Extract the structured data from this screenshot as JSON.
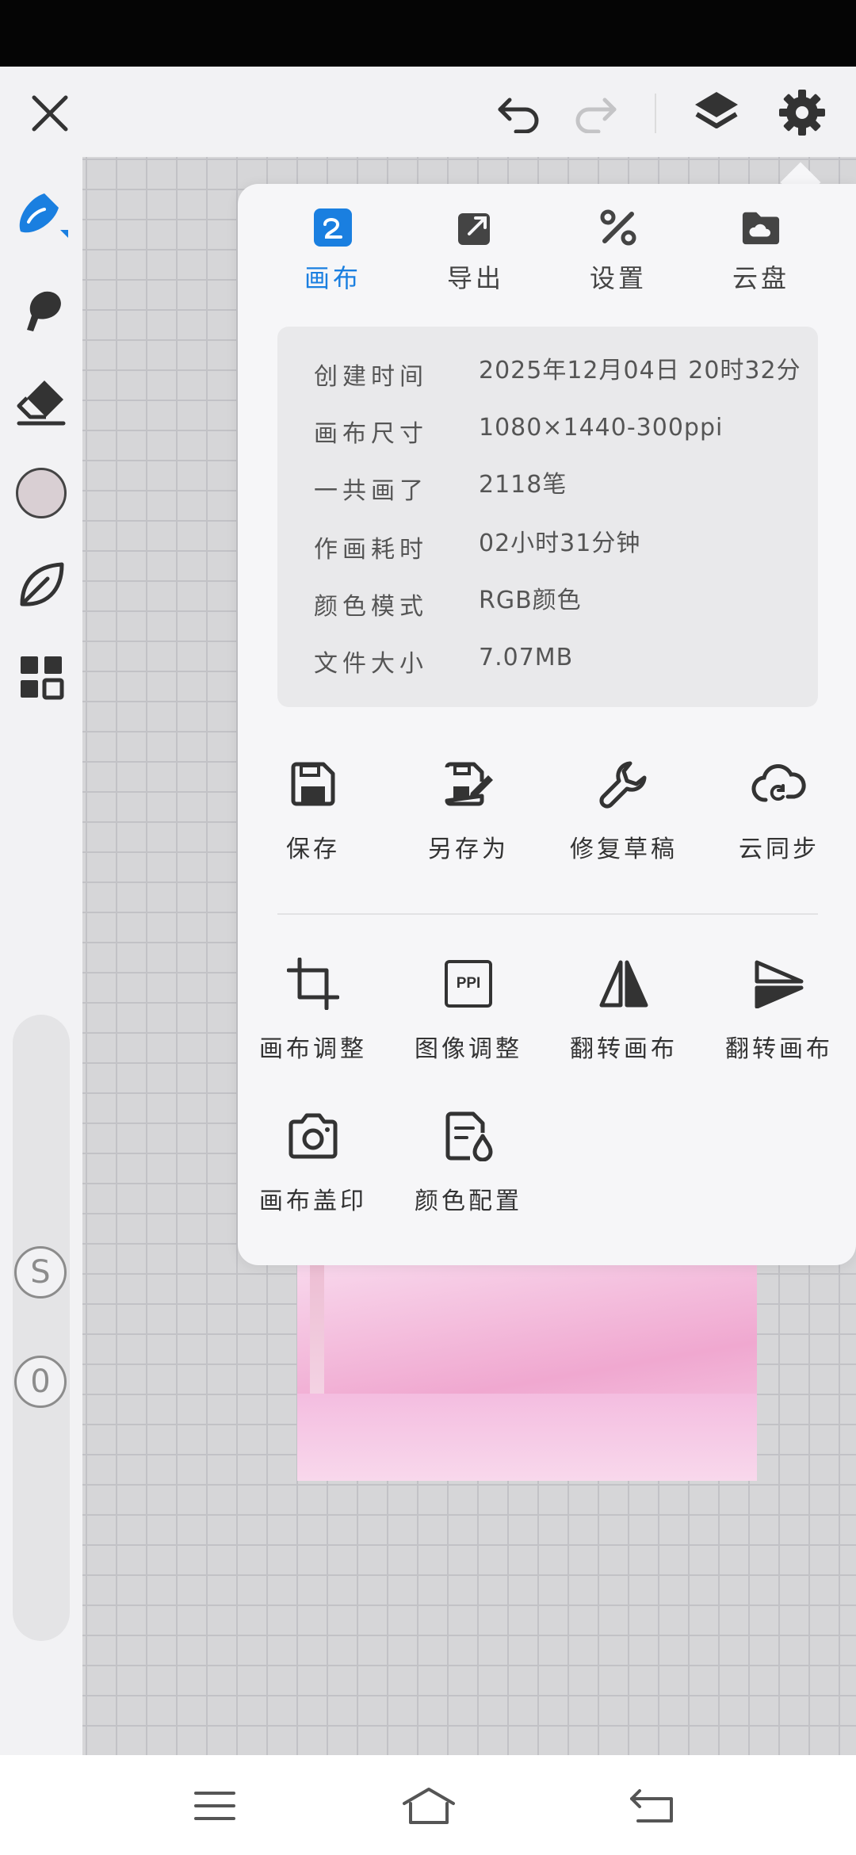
{
  "top_toolbar": {
    "icons": [
      "close-icon",
      "undo-icon",
      "redo-icon",
      "layers-icon",
      "settings-icon"
    ]
  },
  "left_toolbar": {
    "tools": [
      "brush-icon",
      "smudge-icon",
      "eraser-icon",
      "color-swatch",
      "leaf-icon",
      "grid-icon"
    ],
    "current_color": "#d9cfd3",
    "s_button": "S",
    "zero_button": "0"
  },
  "panel": {
    "tabs": [
      {
        "label": "画布",
        "icon": "canvas-icon",
        "active": true
      },
      {
        "label": "导出",
        "icon": "export-icon",
        "active": false
      },
      {
        "label": "设置",
        "icon": "settings-tools-icon",
        "active": false
      },
      {
        "label": "云盘",
        "icon": "cloud-drive-icon",
        "active": false
      }
    ],
    "info": {
      "created_label": "创建时间",
      "created_value": "2025年12月04日 20时32分",
      "size_label": "画布尺寸",
      "size_value": "1080×1440-300ppi",
      "strokes_label": "一共画了",
      "strokes_value": "2118笔",
      "duration_label": "作画耗时",
      "duration_value": "02小时31分钟",
      "color_mode_label": "颜色模式",
      "color_mode_value": "RGB颜色",
      "file_size_label": "文件大小",
      "file_size_value": "7.07MB"
    },
    "actions_row1": [
      {
        "label": "保存",
        "icon": "save-icon"
      },
      {
        "label": "另存为",
        "icon": "save-as-icon"
      },
      {
        "label": "修复草稿",
        "icon": "repair-icon"
      },
      {
        "label": "云同步",
        "icon": "cloud-sync-icon"
      }
    ],
    "actions_row2": [
      {
        "label": "画布调整",
        "icon": "crop-icon"
      },
      {
        "label": "图像调整",
        "icon": "ppi-icon",
        "icon_text": "PPI"
      },
      {
        "label": "翻转画布",
        "icon": "flip-horizontal-icon"
      },
      {
        "label": "翻转画布",
        "icon": "flip-vertical-icon"
      }
    ],
    "actions_row3": [
      {
        "label": "画布盖印",
        "icon": "camera-icon"
      },
      {
        "label": "颜色配置",
        "icon": "color-profile-icon"
      }
    ]
  },
  "colors": {
    "accent": "#1a7fe0",
    "icon": "#333333",
    "panel_bg": "#f6f6f8"
  }
}
